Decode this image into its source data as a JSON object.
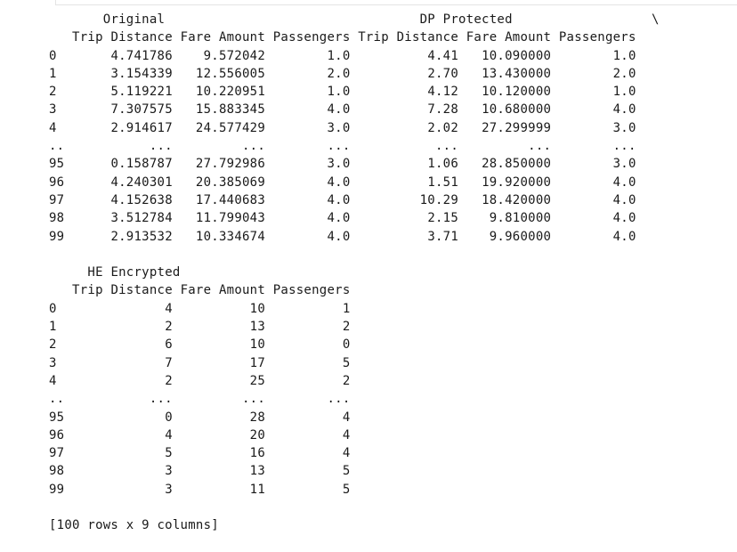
{
  "cell_output": {
    "block1": {
      "group_header_original": "Original",
      "group_header_dp": "DP Protected",
      "continuation_marker": "\\",
      "columns": [
        "Trip Distance",
        "Fare Amount",
        "Passengers",
        "Trip Distance",
        "Fare Amount",
        "Passengers"
      ],
      "rows": [
        [
          "0",
          "4.741786",
          "9.572042",
          "1.0",
          "4.41",
          "10.090000",
          "1.0"
        ],
        [
          "1",
          "3.154339",
          "12.556005",
          "2.0",
          "2.70",
          "13.430000",
          "2.0"
        ],
        [
          "2",
          "5.119221",
          "10.220951",
          "1.0",
          "4.12",
          "10.120000",
          "1.0"
        ],
        [
          "3",
          "7.307575",
          "15.883345",
          "4.0",
          "7.28",
          "10.680000",
          "4.0"
        ],
        [
          "4",
          "2.914617",
          "24.577429",
          "3.0",
          "2.02",
          "27.299999",
          "3.0"
        ],
        [
          "..",
          "...",
          "...",
          "...",
          "...",
          "...",
          "..."
        ],
        [
          "95",
          "0.158787",
          "27.792986",
          "3.0",
          "1.06",
          "28.850000",
          "3.0"
        ],
        [
          "96",
          "4.240301",
          "20.385069",
          "4.0",
          "1.51",
          "19.920000",
          "4.0"
        ],
        [
          "97",
          "4.152638",
          "17.440683",
          "4.0",
          "10.29",
          "18.420000",
          "4.0"
        ],
        [
          "98",
          "3.512784",
          "11.799043",
          "4.0",
          "2.15",
          "9.810000",
          "4.0"
        ],
        [
          "99",
          "2.913532",
          "10.334674",
          "4.0",
          "3.71",
          "9.960000",
          "4.0"
        ]
      ]
    },
    "block2": {
      "group_header_he": "HE Encrypted",
      "columns": [
        "Trip Distance",
        "Fare Amount",
        "Passengers"
      ],
      "rows": [
        [
          "0",
          "4",
          "10",
          "1"
        ],
        [
          "1",
          "2",
          "13",
          "2"
        ],
        [
          "2",
          "6",
          "10",
          "0"
        ],
        [
          "3",
          "7",
          "17",
          "5"
        ],
        [
          "4",
          "2",
          "25",
          "2"
        ],
        [
          "..",
          "...",
          "...",
          "..."
        ],
        [
          "95",
          "0",
          "28",
          "4"
        ],
        [
          "96",
          "4",
          "20",
          "4"
        ],
        [
          "97",
          "5",
          "16",
          "4"
        ],
        [
          "98",
          "3",
          "13",
          "5"
        ],
        [
          "99",
          "3",
          "11",
          "5"
        ]
      ]
    },
    "summary": "[100 rows x 9 columns]"
  }
}
